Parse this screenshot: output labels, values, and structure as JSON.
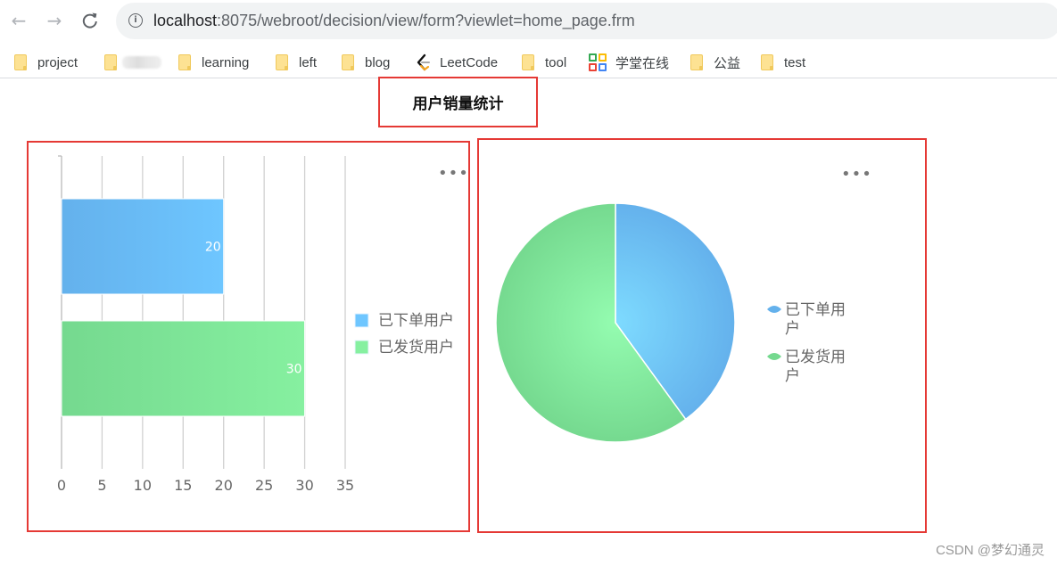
{
  "browser": {
    "back_icon": "←",
    "forward_icon": "→",
    "reload_icon": "C",
    "info_icon": "i",
    "url_host": "localhost",
    "url_path": ":8075/webroot/decision/view/form?viewlet=home_page.frm"
  },
  "bookmarks": [
    {
      "label": "project",
      "icon": "folder-icon"
    },
    {
      "label": "",
      "icon": "folder-icon",
      "redacted": true
    },
    {
      "label": "learning",
      "icon": "folder-icon"
    },
    {
      "label": "left",
      "icon": "folder-icon"
    },
    {
      "label": "blog",
      "icon": "folder-icon"
    },
    {
      "label": "LeetCode",
      "icon": "leetcode-icon"
    },
    {
      "label": "tool",
      "icon": "folder-icon"
    },
    {
      "label": "学堂在线",
      "icon": "xuetangx-icon"
    },
    {
      "label": "公益",
      "icon": "folder-icon"
    },
    {
      "label": "test",
      "icon": "folder-icon"
    }
  ],
  "page": {
    "title": "用户销量统计",
    "more_icon": "•••",
    "watermark": "CSDN @梦幻通灵"
  },
  "colors": {
    "blue": "#67b5f0",
    "blue_light": "#6ec6ff",
    "green": "#79db93",
    "green_light": "#86f0a0",
    "highlight_border": "#e53935",
    "grid": "#cccccc",
    "axis_text": "#666666"
  },
  "chart_data": [
    {
      "type": "bar",
      "orientation": "horizontal",
      "series": [
        {
          "name": "已下单用户",
          "values": [
            20
          ],
          "color": "#67b5f0"
        },
        {
          "name": "已发货用户",
          "values": [
            30
          ],
          "color": "#79db93"
        }
      ],
      "data_labels": [
        "20",
        "30"
      ],
      "xlim": [
        0,
        35
      ],
      "xticks": [
        "0",
        "5",
        "10",
        "15",
        "20",
        "25",
        "30",
        "35"
      ],
      "grid": true,
      "legend": {
        "position": "right",
        "items": [
          "已下单用户",
          "已发货用户"
        ]
      }
    },
    {
      "type": "pie",
      "slices": [
        {
          "name": "已下单用户",
          "value": 20,
          "color": "#67b5f0"
        },
        {
          "name": "已发货用户",
          "value": 30,
          "color": "#79db93"
        }
      ],
      "legend": {
        "position": "right",
        "items": [
          [
            "已下单用",
            "户"
          ],
          [
            "已发货用",
            "户"
          ]
        ]
      }
    }
  ]
}
